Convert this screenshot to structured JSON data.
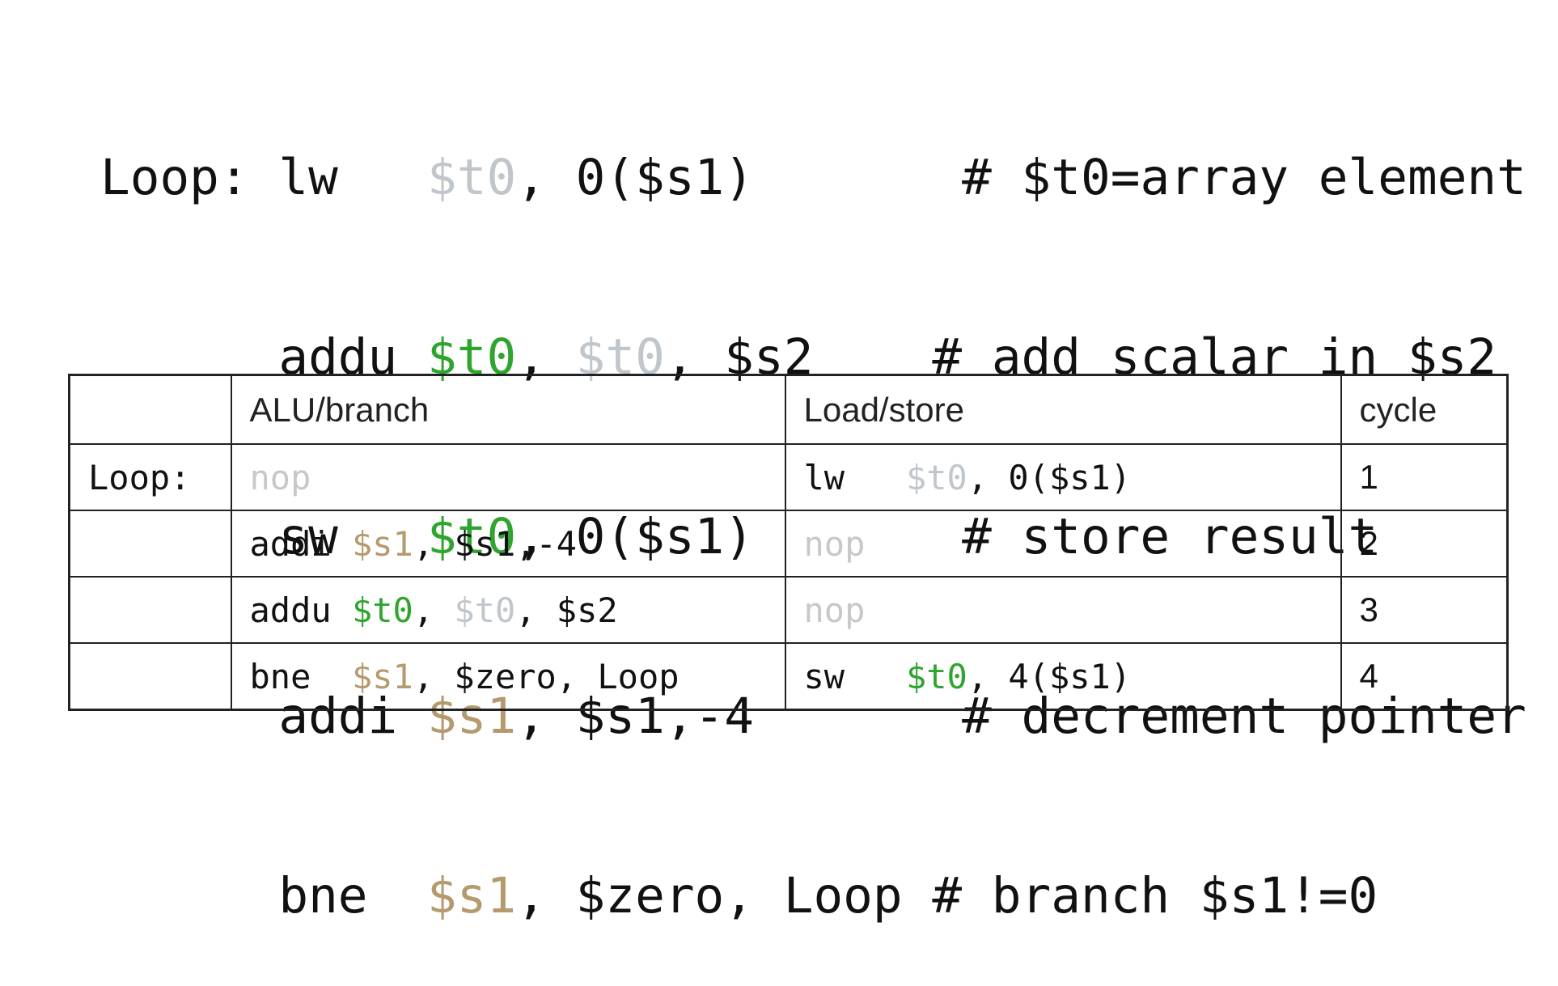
{
  "code": {
    "lines": [
      {
        "label": "Loop:",
        "op": "lw",
        "args": [
          {
            "text": "$t0",
            "color": "grey"
          },
          {
            "text": ", 0($s1)",
            "color": "plain"
          }
        ],
        "pad": "       ",
        "comment": "# $t0=array element"
      },
      {
        "label": "",
        "op": "addu",
        "args": [
          {
            "text": "$t0",
            "color": "green"
          },
          {
            "text": ", ",
            "color": "plain"
          },
          {
            "text": "$t0",
            "color": "grey"
          },
          {
            "text": ", $s2",
            "color": "plain"
          }
        ],
        "pad": "    ",
        "comment": "# add scalar in $s2"
      },
      {
        "label": "",
        "op": "sw",
        "args": [
          {
            "text": "$t0",
            "color": "green"
          },
          {
            "text": ", 0($s1)",
            "color": "plain"
          }
        ],
        "pad": "       ",
        "comment": "# store result"
      },
      {
        "label": "",
        "op": "addi",
        "args": [
          {
            "text": "$s1",
            "color": "tan"
          },
          {
            "text": ", $s1,-4",
            "color": "plain"
          }
        ],
        "pad": "       ",
        "comment": "# decrement pointer"
      },
      {
        "label": "",
        "op": "bne",
        "args": [
          {
            "text": "$s1",
            "color": "tan"
          },
          {
            "text": ", $zero, Loop",
            "color": "plain"
          }
        ],
        "pad": " ",
        "comment": "# branch $s1!=0"
      }
    ]
  },
  "table": {
    "headers": [
      "",
      "ALU/branch",
      "Load/store",
      "cycle"
    ],
    "rows": [
      {
        "label": "Loop:",
        "alu": [
          {
            "text": "nop",
            "color": "dim"
          }
        ],
        "mem": [
          {
            "text": "lw   ",
            "color": "plain"
          },
          {
            "text": "$t0",
            "color": "grey"
          },
          {
            "text": ", 0($s1)",
            "color": "plain"
          }
        ],
        "cycle": "1"
      },
      {
        "label": "",
        "alu": [
          {
            "text": "addi ",
            "color": "plain"
          },
          {
            "text": "$s1",
            "color": "tan"
          },
          {
            "text": ", $s1,-4",
            "color": "plain"
          }
        ],
        "mem": [
          {
            "text": "nop",
            "color": "dim"
          }
        ],
        "cycle": "2"
      },
      {
        "label": "",
        "alu": [
          {
            "text": "addu ",
            "color": "plain"
          },
          {
            "text": "$t0",
            "color": "green"
          },
          {
            "text": ", ",
            "color": "plain"
          },
          {
            "text": "$t0",
            "color": "grey"
          },
          {
            "text": ", $s2",
            "color": "plain"
          }
        ],
        "mem": [
          {
            "text": "nop",
            "color": "dim"
          }
        ],
        "cycle": "3"
      },
      {
        "label": "",
        "alu": [
          {
            "text": "bne  ",
            "color": "plain"
          },
          {
            "text": "$s1",
            "color": "tan"
          },
          {
            "text": ", $zero, Loop",
            "color": "plain"
          }
        ],
        "mem": [
          {
            "text": "sw   ",
            "color": "plain"
          },
          {
            "text": "$t0",
            "color": "green"
          },
          {
            "text": ", 4($s1)",
            "color": "plain"
          }
        ],
        "cycle": "4"
      }
    ]
  },
  "colors": {
    "green": "#2fa52f",
    "tan": "#b49a6e",
    "grey": "#c0c6cc",
    "dim": "#c8c8c8",
    "plain": "#111111"
  }
}
